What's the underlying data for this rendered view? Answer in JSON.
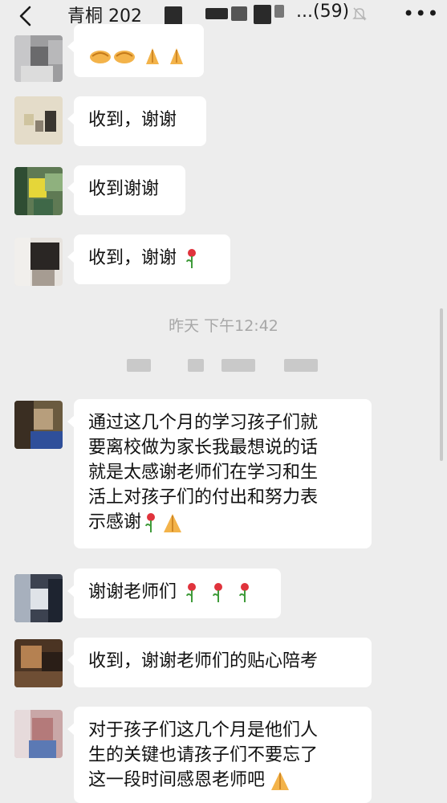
{
  "header": {
    "title": "青桐 202",
    "member_count": "(59)",
    "ellipsis": "...",
    "back_icon": "chevron-left-icon",
    "mute_icon": "bell-muted-icon",
    "more_icon": "more-icon"
  },
  "timestamp": "昨天 下午12:42",
  "messages": [
    {
      "text": "",
      "emojis": [
        "handshake",
        "handshake",
        "pray",
        "pray"
      ]
    },
    {
      "text": "收到，谢谢",
      "emojis": []
    },
    {
      "text": "收到谢谢",
      "emojis": []
    },
    {
      "text": "收到，谢谢",
      "emojis": [
        "rose"
      ]
    },
    {
      "text": "通过这几个月的学习孩子们就要离校做为家长我最想说的话就是太感谢老师们在学习和生活上对孩子们的付出和努力表示感谢",
      "lines": [
        "通过这几个月的学习孩子们就",
        "要离校做为家长我最想说的话",
        "就是太感谢老师们在学习和生",
        "活上对孩子们的付出和努力表",
        "示感谢"
      ],
      "emojis": [
        "rose",
        "pray"
      ]
    },
    {
      "text": "谢谢老师们",
      "emojis": [
        "rose",
        "rose",
        "rose"
      ]
    },
    {
      "text": "收到，谢谢老师们的贴心陪考",
      "emojis": []
    },
    {
      "text": "对于孩子们这几个月是他们人生的关键也请孩子们不要忘了这一段时间感恩老师吧",
      "lines": [
        "对于孩子们这几个月是他们人",
        "生的关键也请孩子们不要忘了",
        "这一段时间感恩老师吧"
      ],
      "emojis": [
        "pray"
      ]
    }
  ]
}
